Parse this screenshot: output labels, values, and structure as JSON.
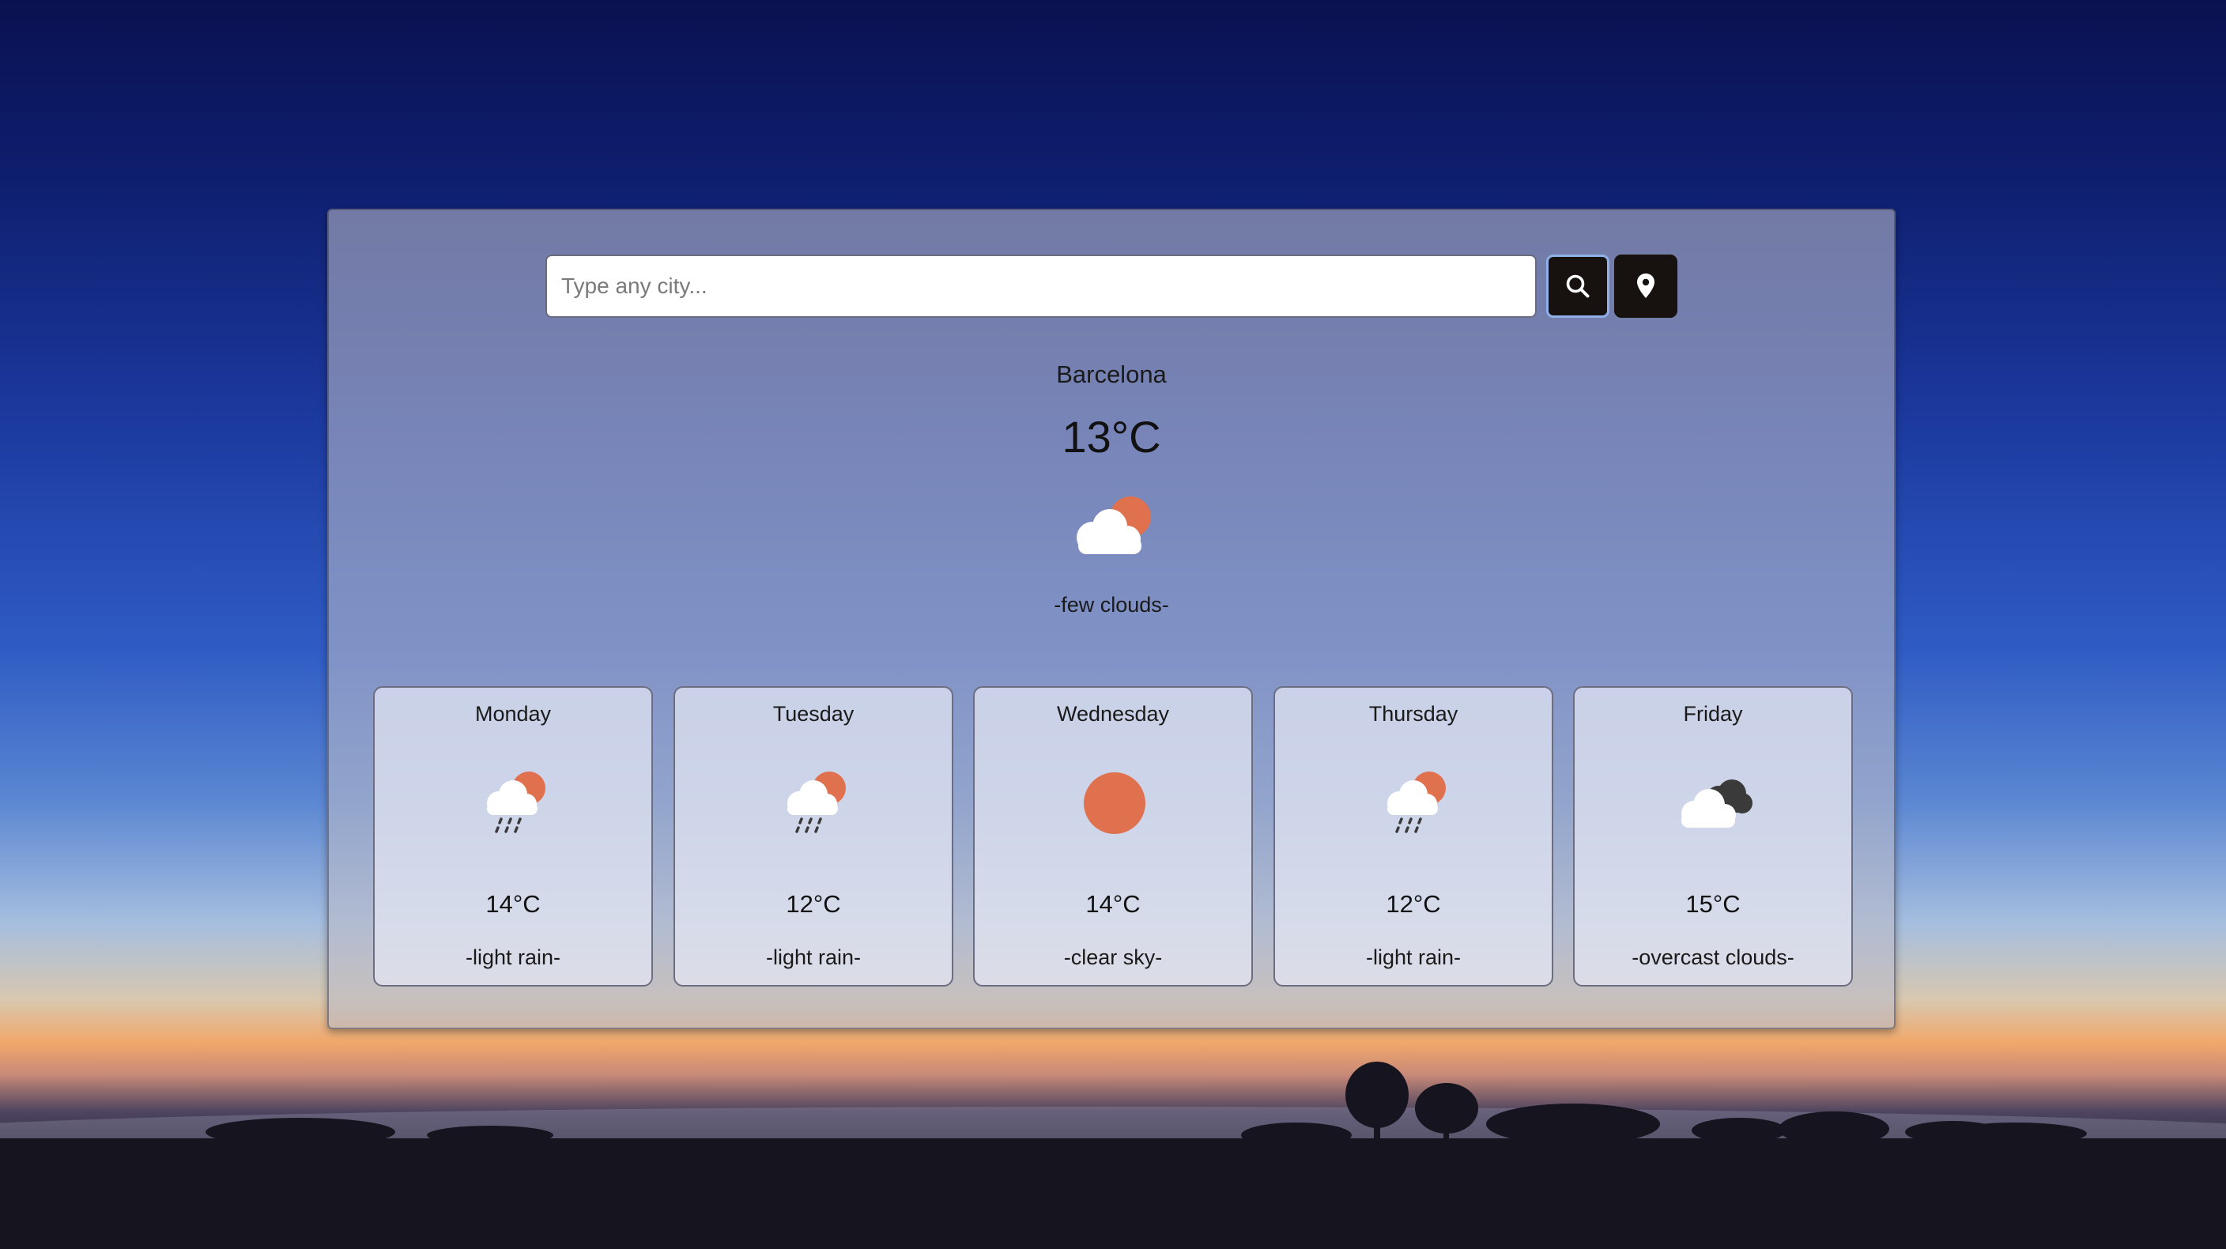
{
  "search": {
    "placeholder": "Type any city..."
  },
  "buttons": {
    "search_icon": "search-icon",
    "location_icon": "location-pin-icon"
  },
  "current": {
    "city": "Barcelona",
    "temperature": "13°C",
    "icon": "few-clouds-icon",
    "description": "-few clouds-"
  },
  "forecast": [
    {
      "day": "Monday",
      "temperature": "14°C",
      "description": "-light rain-",
      "icon": "light-rain-icon"
    },
    {
      "day": "Tuesday",
      "temperature": "12°C",
      "description": "-light rain-",
      "icon": "light-rain-icon"
    },
    {
      "day": "Wednesday",
      "temperature": "14°C",
      "description": "-clear sky-",
      "icon": "clear-sky-icon"
    },
    {
      "day": "Thursday",
      "temperature": "12°C",
      "description": "-light rain-",
      "icon": "light-rain-icon"
    },
    {
      "day": "Friday",
      "temperature": "15°C",
      "description": "-overcast clouds-",
      "icon": "overcast-clouds-icon"
    }
  ],
  "colors": {
    "sun": "#e0714f",
    "cloud": "#ffffff",
    "dark_cloud": "#3a3a3a",
    "button": "#17110f",
    "button_focus_ring": "#8fb0e8"
  }
}
